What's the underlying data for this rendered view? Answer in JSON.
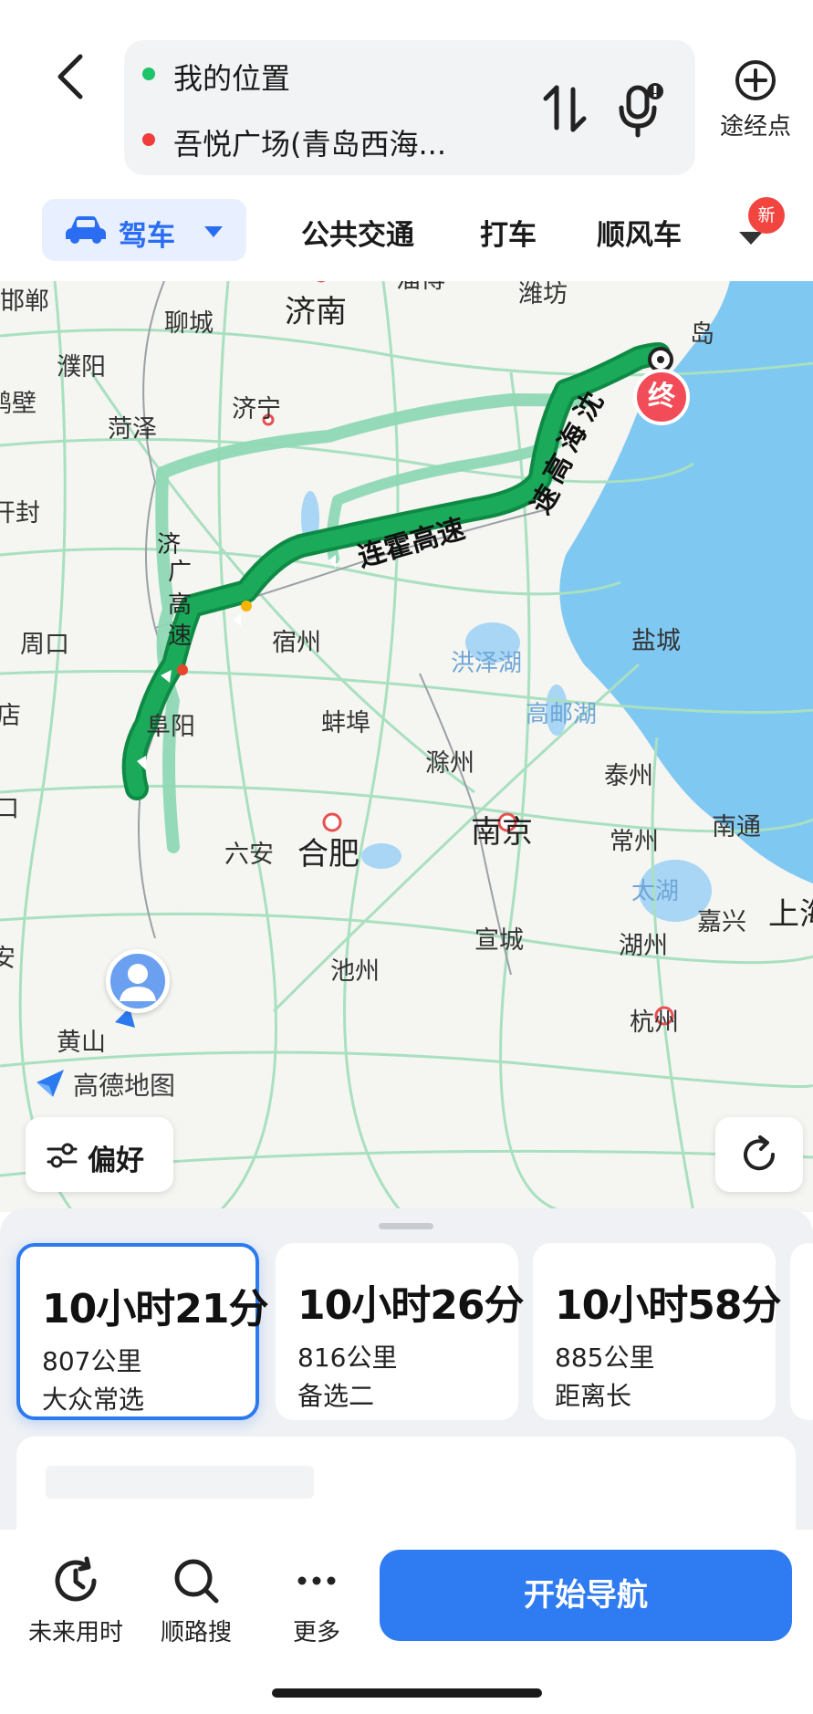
{
  "header": {
    "start_label": "我的位置",
    "dest_label": "吾悦广场(青岛西海...",
    "waypoint_label": "途经点",
    "start_dot_color": "#1ec36a",
    "dest_dot_color": "#f03c3c"
  },
  "tabs": {
    "drive": "驾车",
    "transit": "公共交通",
    "taxi": "打车",
    "carpool": "顺风车",
    "new_badge": "新",
    "accent": "#2b6df2"
  },
  "map": {
    "cities": {
      "handan": "邯郸",
      "liaocheng": "聊城",
      "jinan": "济南",
      "zibo": "淄博",
      "weifang": "潍坊",
      "qingdao": "岛",
      "puyang": "濮阳",
      "hebi": "鹤壁",
      "jining": "济宁",
      "heze": "菏泽",
      "kaifeng": "开封",
      "zhoukou": "周口",
      "suzhou_ah": "宿州",
      "bengbu": "蚌埠",
      "fuyang": "阜阳",
      "yancheng": "盐城",
      "hongze": "洪泽湖",
      "gaoyou": "高邮湖",
      "chuzhou": "滁州",
      "taizhou": "泰州",
      "nanjing": "南京",
      "changzhou": "常州",
      "nantong": "南通",
      "luan": "六安",
      "hefei": "合肥",
      "taihu": "太湖",
      "jiaxing": "嘉兴",
      "shanghai": "上海",
      "xuancheng": "宣城",
      "huzhou": "湖州",
      "chizhou": "池州",
      "huangshan": "黄山",
      "hangzhou": "杭州",
      "xinyang_partial": "店",
      "luohe_partial": "口",
      "zhengzhou_partial": "济",
      "anqing_partial": "安"
    },
    "roads": {
      "shenhai": [
        "沈",
        "海",
        "高",
        "速"
      ],
      "lianhuo": "连霍高速",
      "jiguang": [
        "济",
        "广",
        "高",
        "速"
      ]
    },
    "end_pin": "终",
    "logo_text": "高德地图",
    "pref_label": "偏好",
    "route_color": "#1aaa5a",
    "alt_route_color": "#8fd8b4",
    "sea_color": "#7fc8f2"
  },
  "routes": [
    {
      "time": "10小时21分",
      "distance": "807公里",
      "tag": "大众常选"
    },
    {
      "time": "10小时26分",
      "distance": "816公里",
      "tag": "备选二"
    },
    {
      "time": "10小时58分",
      "distance": "885公里",
      "tag": "距离长"
    }
  ],
  "toolbar": {
    "future_time": "未来用时",
    "along_search": "顺路搜",
    "more": "更多",
    "start_nav": "开始导航"
  }
}
